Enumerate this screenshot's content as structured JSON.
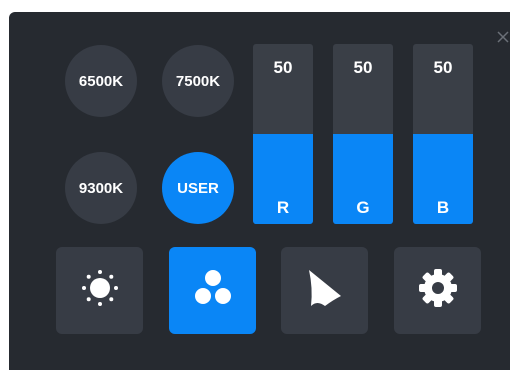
{
  "presets": [
    {
      "label": "6500K",
      "active": false
    },
    {
      "label": "7500K",
      "active": false
    },
    {
      "label": "9300K",
      "active": false
    },
    {
      "label": "USER",
      "active": true
    }
  ],
  "rgb": [
    {
      "channel": "R",
      "value": "50",
      "level": 0.5
    },
    {
      "channel": "G",
      "value": "50",
      "level": 0.5
    },
    {
      "channel": "B",
      "value": "50",
      "level": 0.5
    }
  ],
  "modes": [
    {
      "icon": "brightness-icon",
      "active": false
    },
    {
      "icon": "color-channels-icon",
      "active": true
    },
    {
      "icon": "gamma-icon",
      "active": false
    },
    {
      "icon": "gear-icon",
      "active": false
    }
  ],
  "colors": {
    "panel": "#262a30",
    "button": "#373c45",
    "accent": "#0a86f6"
  }
}
